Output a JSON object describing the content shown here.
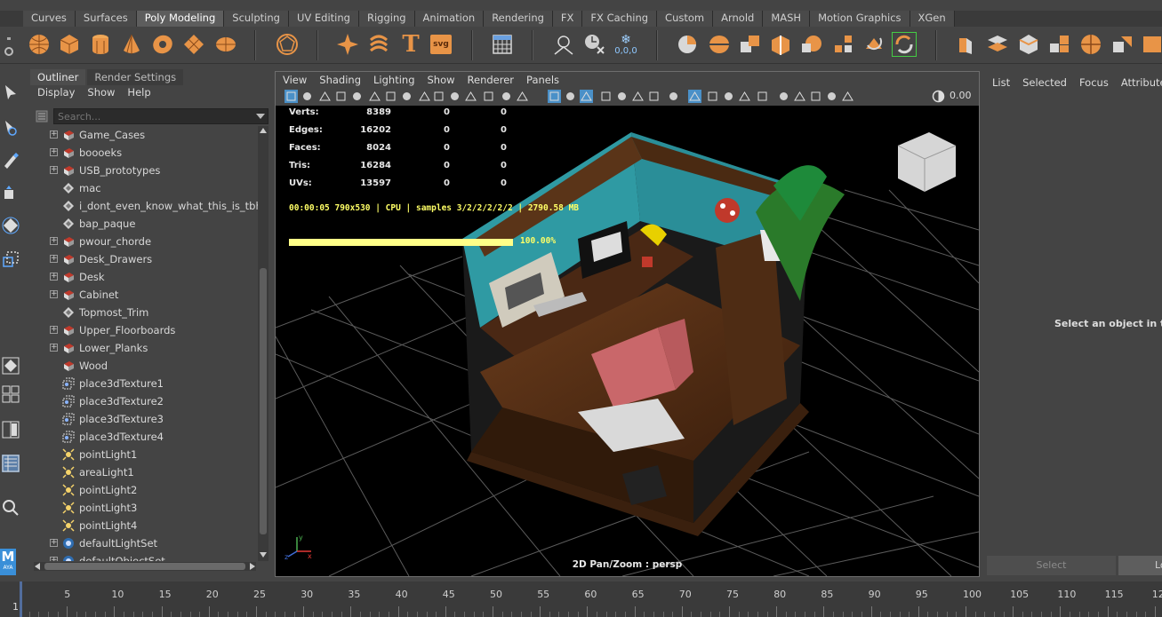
{
  "shelf_tabs": [
    "Curves",
    "Surfaces",
    "Poly Modeling",
    "Sculpting",
    "UV Editing",
    "Rigging",
    "Animation",
    "Rendering",
    "FX",
    "FX Caching",
    "Custom",
    "Arnold",
    "MASH",
    "Motion Graphics",
    "XGen"
  ],
  "shelf_active_tab": "Poly Modeling",
  "shelf_icon_text": {
    "text_tool": "T",
    "svg_tool": "svg",
    "coords": "0,0,0"
  },
  "outliner": {
    "tabs": [
      "Outliner",
      "Render Settings"
    ],
    "menu": [
      "Display",
      "Show",
      "Help"
    ],
    "search_placeholder": "Search...",
    "items": [
      {
        "label": "Game_Cases",
        "icon": "mesh-icon",
        "expandable": true
      },
      {
        "label": "boooeks",
        "icon": "mesh-icon",
        "expandable": true
      },
      {
        "label": "USB_prototypes",
        "icon": "mesh-icon",
        "expandable": true
      },
      {
        "label": "mac",
        "icon": "group-icon",
        "expandable": false
      },
      {
        "label": "i_dont_even_know_what_this_is_tbh",
        "icon": "group-icon",
        "expandable": false
      },
      {
        "label": "bap_paque",
        "icon": "group-icon",
        "expandable": false
      },
      {
        "label": "pwour_chorde",
        "icon": "mesh-icon",
        "expandable": true
      },
      {
        "label": "Desk_Drawers",
        "icon": "mesh-icon",
        "expandable": true
      },
      {
        "label": "Desk",
        "icon": "mesh-icon",
        "expandable": true
      },
      {
        "label": "Cabinet",
        "icon": "mesh-icon",
        "expandable": true
      },
      {
        "label": "Topmost_Trim",
        "icon": "group-icon",
        "expandable": false
      },
      {
        "label": "Upper_Floorboards",
        "icon": "mesh-icon",
        "expandable": true
      },
      {
        "label": "Lower_Planks",
        "icon": "mesh-icon",
        "expandable": true
      },
      {
        "label": "Wood",
        "icon": "mesh-icon",
        "expandable": false
      },
      {
        "label": "place3dTexture1",
        "icon": "place3d-icon",
        "expandable": false
      },
      {
        "label": "place3dTexture2",
        "icon": "place3d-icon",
        "expandable": false
      },
      {
        "label": "place3dTexture3",
        "icon": "place3d-icon",
        "expandable": false
      },
      {
        "label": "place3dTexture4",
        "icon": "place3d-icon",
        "expandable": false
      },
      {
        "label": "pointLight1",
        "icon": "light-icon",
        "expandable": false
      },
      {
        "label": "areaLight1",
        "icon": "light-icon",
        "expandable": false
      },
      {
        "label": "pointLight2",
        "icon": "light-icon",
        "expandable": false
      },
      {
        "label": "pointLight3",
        "icon": "light-icon",
        "expandable": false
      },
      {
        "label": "pointLight4",
        "icon": "light-icon",
        "expandable": false
      },
      {
        "label": "defaultLightSet",
        "icon": "set-icon",
        "expandable": true
      },
      {
        "label": "defaultObjectSet",
        "icon": "set-icon",
        "expandable": true
      }
    ]
  },
  "viewport": {
    "menu": [
      "View",
      "Shading",
      "Lighting",
      "Show",
      "Renderer",
      "Panels"
    ],
    "toolbar_value": "0.00",
    "hud": {
      "labels": [
        "Verts:",
        "Edges:",
        "Faces:",
        "Tris:",
        "UVs:"
      ],
      "col1": [
        "8389",
        "16202",
        "8024",
        "16284",
        "13597"
      ],
      "col2": [
        "0",
        "0",
        "0",
        "0",
        "0"
      ],
      "col3": [
        "0",
        "0",
        "0",
        "0",
        "0"
      ]
    },
    "render_info": "00:00:05 790x530 | CPU | samples 3/2/2/2/2/2 | 2790.58 MB",
    "progress_percent": 100,
    "progress_text": "100.00%",
    "camera_label": "2D Pan/Zoom : persp",
    "axis_labels": {
      "x": "x",
      "y": "y",
      "z": "z"
    }
  },
  "attribute_editor": {
    "menu": [
      "List",
      "Selected",
      "Focus",
      "Attributes"
    ],
    "message": "Select an object in the s",
    "select_button": "Select",
    "load_button": "Lo"
  },
  "timeline": {
    "current_frame": "1",
    "ticks": [
      "5",
      "10",
      "15",
      "20",
      "25",
      "30",
      "35",
      "40",
      "45",
      "50",
      "55",
      "60",
      "65",
      "70",
      "75",
      "80",
      "85",
      "90",
      "95",
      "100",
      "105",
      "110",
      "115",
      "12"
    ]
  },
  "toolbox": {
    "maya_logo": "M",
    "maya_logo_sub": "AYA"
  },
  "colors": {
    "shelf_icon_orange": "#f0a050",
    "hud_yellow": "#ffff66",
    "teal_wall": "#2fa0a6",
    "wood": "#5a3418"
  }
}
